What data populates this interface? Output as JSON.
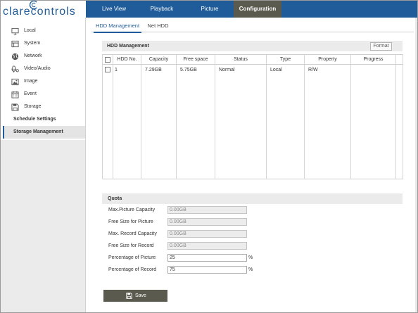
{
  "logo": {
    "text": "clarecontrols"
  },
  "nav": {
    "items": [
      {
        "label": "Live View"
      },
      {
        "label": "Playback"
      },
      {
        "label": "Picture"
      },
      {
        "label": "Configuration",
        "active": true
      }
    ]
  },
  "sidebar": {
    "items": [
      {
        "label": "Local",
        "icon": "monitor-icon"
      },
      {
        "label": "System",
        "icon": "system-window-icon"
      },
      {
        "label": "Network",
        "icon": "globe-icon"
      },
      {
        "label": "Video/Audio",
        "icon": "microphone-camera-icon"
      },
      {
        "label": "Image",
        "icon": "image-icon"
      },
      {
        "label": "Event",
        "icon": "calendar-icon"
      },
      {
        "label": "Storage",
        "icon": "storage-disk-icon"
      }
    ],
    "storage_subitems": [
      {
        "label": "Schedule Settings"
      },
      {
        "label": "Storage Management",
        "active": true
      }
    ]
  },
  "tabs": [
    {
      "label": "HDD Management",
      "active": true
    },
    {
      "label": "Net HDD"
    }
  ],
  "hdd": {
    "title": "HDD Management",
    "format_label": "Format",
    "select_all_checked": false,
    "columns": [
      "HDD No.",
      "Capacity",
      "Free space",
      "Status",
      "Type",
      "Property",
      "Progress"
    ],
    "rows": [
      {
        "checked": false,
        "hdd_no": "1",
        "capacity": "7.29GB",
        "free_space": "5.75GB",
        "status": "Normal",
        "type": "Local",
        "property": "R/W"
      }
    ]
  },
  "quota": {
    "title": "Quota",
    "fields": [
      {
        "label": "Max.Picture Capacity",
        "value": "0.00GB",
        "editable": false
      },
      {
        "label": "Free Size for Picture",
        "value": "0.00GB",
        "editable": false
      },
      {
        "label": "Max. Record Capacity",
        "value": "0.00GB",
        "editable": false
      },
      {
        "label": "Free Size for Record",
        "value": "0.00GB",
        "editable": false
      },
      {
        "label": "Percentage of Picture",
        "value": "25",
        "unit": "%",
        "editable": true
      },
      {
        "label": "Percentage of Record",
        "value": "75",
        "unit": "%",
        "editable": true
      }
    ]
  },
  "save": {
    "label": "Save",
    "icon": "floppy-disk-icon"
  },
  "colors": {
    "topbar": "#1f5c99",
    "active_nav": "#5b5a4f",
    "accent": "#1f5c99",
    "save_button": "#5b5a4f"
  }
}
